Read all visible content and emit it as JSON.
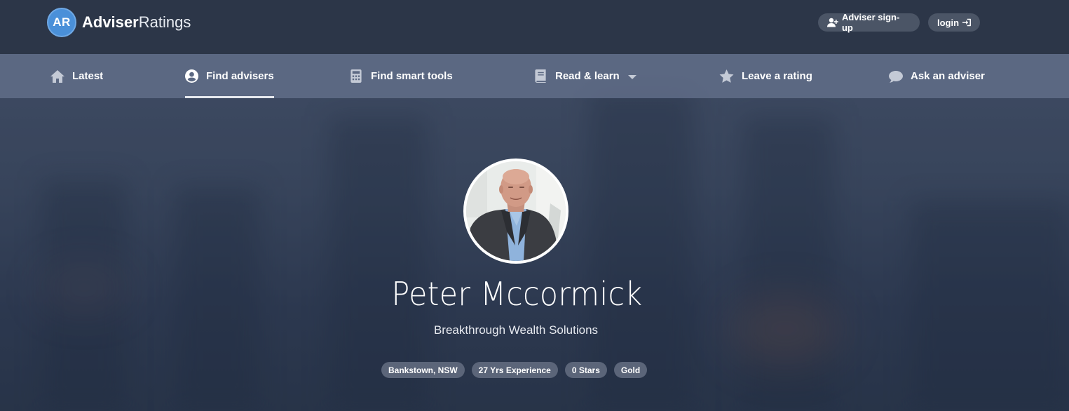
{
  "header": {
    "logo": {
      "badge": "AR",
      "name_bold": "Adviser",
      "name_light": "Ratings"
    },
    "signup_label": "Adviser sign-up",
    "login_label": "login"
  },
  "nav": {
    "items": [
      {
        "label": "Latest",
        "icon": "home-icon"
      },
      {
        "label": "Find advisers",
        "icon": "user-circle-icon",
        "active": true
      },
      {
        "label": "Find smart tools",
        "icon": "calculator-icon"
      },
      {
        "label": "Read & learn",
        "icon": "book-icon",
        "dropdown": true
      },
      {
        "label": "Leave a rating",
        "icon": "star-icon"
      },
      {
        "label": "Ask an adviser",
        "icon": "chat-bubble-icon"
      }
    ]
  },
  "profile": {
    "name": "Peter Mccormick",
    "company": "Breakthrough Wealth Solutions",
    "tags": [
      "Bankstown, NSW",
      "27 Yrs Experience",
      "0 Stars",
      "Gold"
    ]
  },
  "colors": {
    "header_bg": "#2c3648",
    "nav_bg": "#64718c",
    "logo_blue": "#4a90d9",
    "tag_bg": "#5b6579"
  }
}
